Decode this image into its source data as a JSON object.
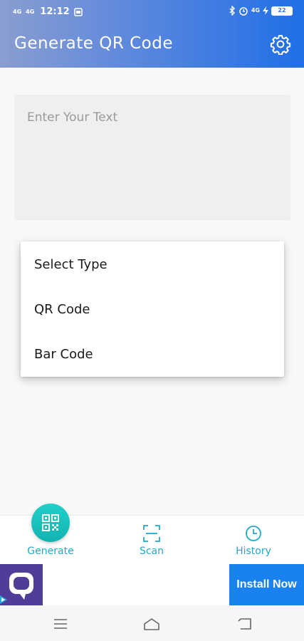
{
  "status_bar": {
    "signal1": "4G",
    "signal2": "4G",
    "time": "12:12",
    "right_net": "4G",
    "battery": "22"
  },
  "header": {
    "title": "Generate QR Code",
    "settings_icon": "gear-icon"
  },
  "input": {
    "placeholder": "Enter Your Text"
  },
  "dropdown": {
    "items": [
      "Select Type",
      "QR Code",
      "Bar Code"
    ]
  },
  "bottom_nav": {
    "items": [
      {
        "label": "Generate",
        "icon": "qr-icon"
      },
      {
        "label": "Scan",
        "icon": "scan-frame-icon"
      },
      {
        "label": "History",
        "icon": "clock-icon"
      }
    ]
  },
  "ad": {
    "button": "Install Now"
  },
  "colors": {
    "accent": "#22a8c9",
    "header_start": "#8a9ed0",
    "header_end": "#1f6fe6",
    "install_button": "#1a82f0"
  }
}
